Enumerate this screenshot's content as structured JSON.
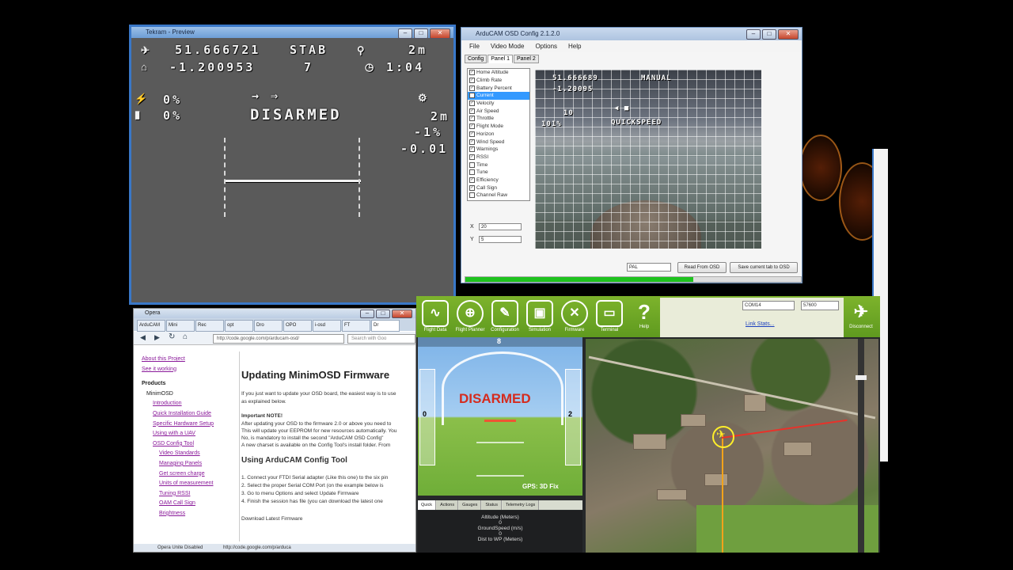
{
  "osd_window": {
    "title": "Tekram - Preview",
    "lat": "51.666721",
    "lon": "-1.200953",
    "mode": "STAB",
    "sats": "7",
    "alt_top": "2m",
    "time": "1:04",
    "throttle": "0%",
    "batt": "0%",
    "status": "DISARMED",
    "alt_right": "2m",
    "climb": "-1%",
    "vario": "-0.01"
  },
  "config_tool": {
    "title": "ArduCAM OSD Config 2.1.2.0",
    "menu": [
      "File",
      "Video Mode",
      "Options",
      "Help"
    ],
    "tabs": [
      "Config",
      "Panel 1",
      "Panel 2"
    ],
    "items": [
      "Home Altitude",
      "Climb Rate",
      "Battery Percent",
      "Current",
      "Velocity",
      "Air Speed",
      "Throttle",
      "Flight Mode",
      "Horizon",
      "Wind Speed",
      "Warnings",
      "RSSI",
      "Time",
      "Tune",
      "Efficiency",
      "Call Sign",
      "Channel Raw"
    ],
    "selected_item": "Current",
    "x_label": "X",
    "x_value": "20",
    "y_label": "Y",
    "y_value": "5",
    "preview_lat": "51.666689",
    "preview_lon": "-1.20095",
    "preview_mode": "MANUAL",
    "preview_speed": "QUICKSPEED",
    "preview_pct": "101%",
    "preview_eq": "10",
    "video_mode": "PAL",
    "btn_read": "Read From OSD",
    "btn_write": "Save current tab to OSD",
    "progress": 0.68
  },
  "opera": {
    "title": "Opera",
    "tabs": [
      "ArduCAM",
      "Mini",
      "Rec",
      "opt",
      "Dro",
      "OPO",
      "i-osd",
      "FT",
      "Dr"
    ],
    "address": "http://code.google.com/p/arducam-osd/",
    "search_placeholder": "Search with Goo",
    "side_links": [
      "About this Project",
      "See it working"
    ],
    "products_label": "Products",
    "minimosd_label": "MinimOSD",
    "sub_links": [
      "Introduction",
      "Quick Installation Guide",
      "Specific Hardware Setup",
      "Using with a UAV"
    ],
    "config_tool_label": "OSD Config Tool",
    "config_sub_links": [
      "Video Standards",
      "Managing Panels",
      "Get screen charge",
      "Units of measurement",
      "Tuning RSSI",
      "OAM Call Sign",
      "Brightness"
    ],
    "page_title": "Updating MinimOSD Firmware",
    "intro": "If you just want to update your OSD board, the easiest way is to use",
    "intro2": "as explained below.",
    "important": "Important NOTE!",
    "note1": "After updating your OSD to the firmware 2.0 or above you need to",
    "note2": "This will update your EEPROM for new resources automatically. You",
    "note3": "No, is mandatory to install the second \"ArduCAM OSD Config\"",
    "note4": "A new charset is available on the Config Tool's install folder. From",
    "section": "Using ArduCAM Config Tool",
    "steps": [
      "1. Connect your FTDI Serial adapter (Like this one) to the six pin",
      "2. Select the proper Serial COM Port (on the example below is",
      "3. Go to menu Options and select Update Firmware",
      "4. Finish the session has file (you can download the latest one"
    ],
    "download": "Download Latest Firmware",
    "status": "Opera Unite Disabled",
    "status_url": "http://code.google.com/p/arduca"
  },
  "mission_planner": {
    "toolbar": [
      "Flight Data",
      "Flight Planner",
      "Configuration",
      "Simulation",
      "Firmware",
      "Terminal",
      "Help"
    ],
    "port": "COM14",
    "baud": "57600",
    "link_stats": "Link Stats...",
    "connect": "Disconnect",
    "hud_status": "DISARMED",
    "hud_gps": "GPS: 3D Fix",
    "hud_heading": "8",
    "hud_speed_left": "0",
    "hud_alt_right": "2",
    "hud_tabs": [
      "Quick",
      "Actions",
      "Gauges",
      "Status",
      "Telemetry Logs"
    ],
    "quick_items": [
      "Altitude (Meters)",
      "0",
      "GroundSpeed (m/s)",
      "0",
      "Dist to WP (Meters)"
    ]
  },
  "icons": {
    "osd_sat": "satellite-icon",
    "osd_home": "home-icon",
    "mp_fd": "flight-data-icon",
    "mp_fp": "flight-planner-icon",
    "mp_cfg": "wrench-icon",
    "mp_sim": "simulation-icon",
    "mp_fw": "firmware-icon",
    "mp_term": "terminal-icon",
    "mp_help": "help-icon",
    "mp_connect": "plane-icon"
  },
  "colors": {
    "mp_green": "#6fa626",
    "hud_red": "#d52b1e",
    "progress_green": "#1ec31e",
    "window_blue": "#3a78c8"
  }
}
